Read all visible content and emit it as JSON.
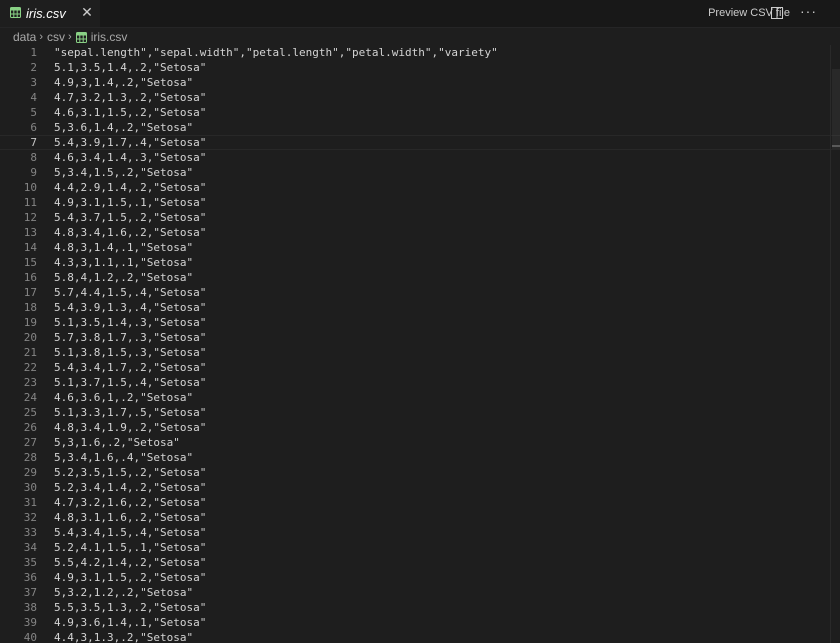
{
  "tab": {
    "label": "iris.csv",
    "close_glyph": "✕",
    "icon": "table-icon"
  },
  "toolbar": {
    "preview_label": "Preview CSV file",
    "split_icon": "split-editor-icon",
    "more_glyph": "···"
  },
  "breadcrumb": {
    "items": [
      "data",
      "csv",
      "iris.csv"
    ],
    "separator": "›"
  },
  "editor": {
    "current_line": 7,
    "lines": [
      "\"sepal.length\",\"sepal.width\",\"petal.length\",\"petal.width\",\"variety\"",
      "5.1,3.5,1.4,.2,\"Setosa\"",
      "4.9,3,1.4,.2,\"Setosa\"",
      "4.7,3.2,1.3,.2,\"Setosa\"",
      "4.6,3.1,1.5,.2,\"Setosa\"",
      "5,3.6,1.4,.2,\"Setosa\"",
      "5.4,3.9,1.7,.4,\"Setosa\"",
      "4.6,3.4,1.4,.3,\"Setosa\"",
      "5,3.4,1.5,.2,\"Setosa\"",
      "4.4,2.9,1.4,.2,\"Setosa\"",
      "4.9,3.1,1.5,.1,\"Setosa\"",
      "5.4,3.7,1.5,.2,\"Setosa\"",
      "4.8,3.4,1.6,.2,\"Setosa\"",
      "4.8,3,1.4,.1,\"Setosa\"",
      "4.3,3,1.1,.1,\"Setosa\"",
      "5.8,4,1.2,.2,\"Setosa\"",
      "5.7,4.4,1.5,.4,\"Setosa\"",
      "5.4,3.9,1.3,.4,\"Setosa\"",
      "5.1,3.5,1.4,.3,\"Setosa\"",
      "5.7,3.8,1.7,.3,\"Setosa\"",
      "5.1,3.8,1.5,.3,\"Setosa\"",
      "5.4,3.4,1.7,.2,\"Setosa\"",
      "5.1,3.7,1.5,.4,\"Setosa\"",
      "4.6,3.6,1,.2,\"Setosa\"",
      "5.1,3.3,1.7,.5,\"Setosa\"",
      "4.8,3.4,1.9,.2,\"Setosa\"",
      "5,3,1.6,.2,\"Setosa\"",
      "5,3.4,1.6,.4,\"Setosa\"",
      "5.2,3.5,1.5,.2,\"Setosa\"",
      "5.2,3.4,1.4,.2,\"Setosa\"",
      "4.7,3.2,1.6,.2,\"Setosa\"",
      "4.8,3.1,1.6,.2,\"Setosa\"",
      "5.4,3.4,1.5,.4,\"Setosa\"",
      "5.2,4.1,1.5,.1,\"Setosa\"",
      "5.5,4.2,1.4,.2,\"Setosa\"",
      "4.9,3.1,1.5,.2,\"Setosa\"",
      "5,3.2,1.2,.2,\"Setosa\"",
      "5.5,3.5,1.3,.2,\"Setosa\"",
      "4.9,3.6,1.4,.1,\"Setosa\"",
      "4.4,3,1.3,.2,\"Setosa\""
    ]
  },
  "colors": {
    "background": "#1e1e1e",
    "tab_bar": "#181818",
    "csv_icon": "#89d185",
    "line_number": "#858585",
    "text": "#d4d4d4"
  }
}
